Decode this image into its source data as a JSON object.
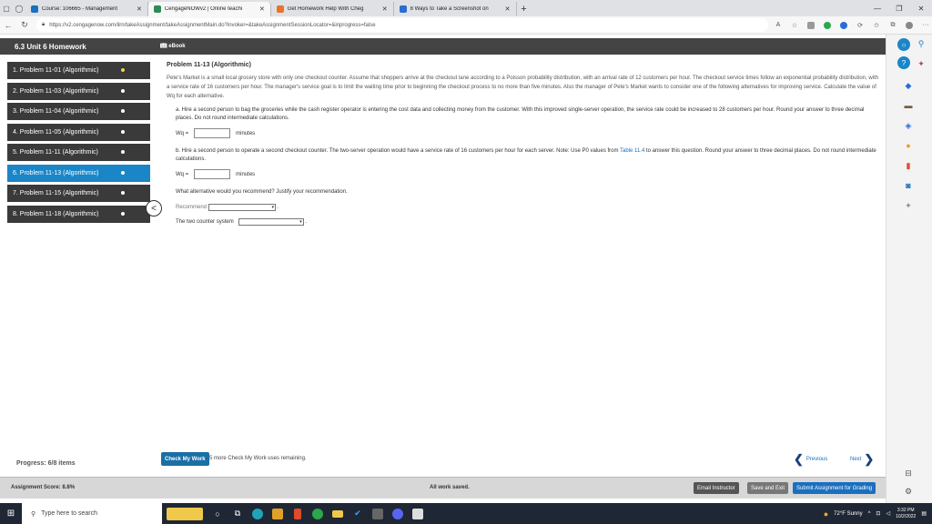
{
  "browser": {
    "tabs": [
      {
        "label": "Course: 106665 - Management",
        "fav_color": "#1a6fbf"
      },
      {
        "label": "CengageNOWv2 | Online teachi",
        "fav_color": "#2e8b57",
        "active": true
      },
      {
        "label": "Get Homework Help With Cheg",
        "fav_color": "#e8732a"
      },
      {
        "label": "8 Ways to Take a Screenshot on",
        "fav_color": "#2b6cd4"
      }
    ],
    "url": "https://v2.cengagenow.com/ilrn/takeAssignment/takeAssignmentMain.do?invoker=&takeAssignmentSessionLocator=&inprogress=false"
  },
  "app": {
    "title": "6.3 Unit 6 Homework",
    "ebook": "eBook",
    "sidebar": [
      {
        "label": "1. Problem 11-01 (Algorithmic)",
        "dot": "yellow"
      },
      {
        "label": "2. Problem 11-03 (Algorithmic)",
        "dot": "white"
      },
      {
        "label": "3. Problem 11-04 (Algorithmic)",
        "dot": "white"
      },
      {
        "label": "4. Problem 11-05 (Algorithmic)",
        "dot": "white"
      },
      {
        "label": "5. Problem 11-11 (Algorithmic)",
        "dot": "white"
      },
      {
        "label": "6. Problem 11-13 (Algorithmic)",
        "dot": "white",
        "active": true
      },
      {
        "label": "7. Problem 11-15 (Algorithmic)",
        "dot": "white"
      },
      {
        "label": "8. Problem 11-18 (Algorithmic)",
        "dot": "white"
      }
    ],
    "problem": {
      "title": "Problem 11-13 (Algorithmic)",
      "intro": "Pete's Market is a small local grocery store with only one checkout counter. Assume that shoppers arrive at the checkout lane according to a Poisson probability distribution, with an arrival rate of 12 customers per hour. The checkout service times follow an exponential probability distribution, with a service rate of 16 customers per hour. The manager's service goal is to limit the waiting time prior to beginning the checkout process to no more than five minutes. Also the manager of Pete's Market wants to consider one of the following alternatives for improving service. Calculate the value of Wq for each alternative.",
      "part_a": "a. Hire a second person to bag the groceries while the cash register operator is entering the cost data and collecting money from the customer. With this improved single-server operation, the service rate could be increased to 28 customers per hour. Round your answer to three decimal places. Do not round intermediate calculations.",
      "part_a_var": "Wq =",
      "part_a_unit": "minutes",
      "part_b_pre": "b. Hire a second person to operate a second checkout counter. The two-server operation would have a service rate of 16 customers per hour for each server. Note: Use P0 values from ",
      "part_b_link": "Table 11.4",
      "part_b_post": " to answer this question. Round your answer to three decimal places. Do not round intermediate calculations.",
      "part_b_var": "Wq =",
      "part_b_unit": "minutes",
      "question": "What alternative would you recommend? Justify your recommendation.",
      "recommend_label": "Recommend",
      "recommend_value": "",
      "justify_label": "The two counter system",
      "justify_value": ""
    },
    "progress": "Progress: 6/8 items",
    "check_btn": "Check My Work",
    "check_info": "5 more Check My Work uses remaining.",
    "previous": "Previous",
    "next": "Next",
    "score": "Assignment Score: 8.8%",
    "saved": "All work saved.",
    "email_btn": "Email Instructor",
    "save_exit_btn": "Save and Exit",
    "submit_btn": "Submit Assignment for Grading"
  },
  "taskbar": {
    "search_placeholder": "Type here to search",
    "weather": "72°F Sunny",
    "time": "3:32 PM",
    "date": "10/2/2022"
  }
}
